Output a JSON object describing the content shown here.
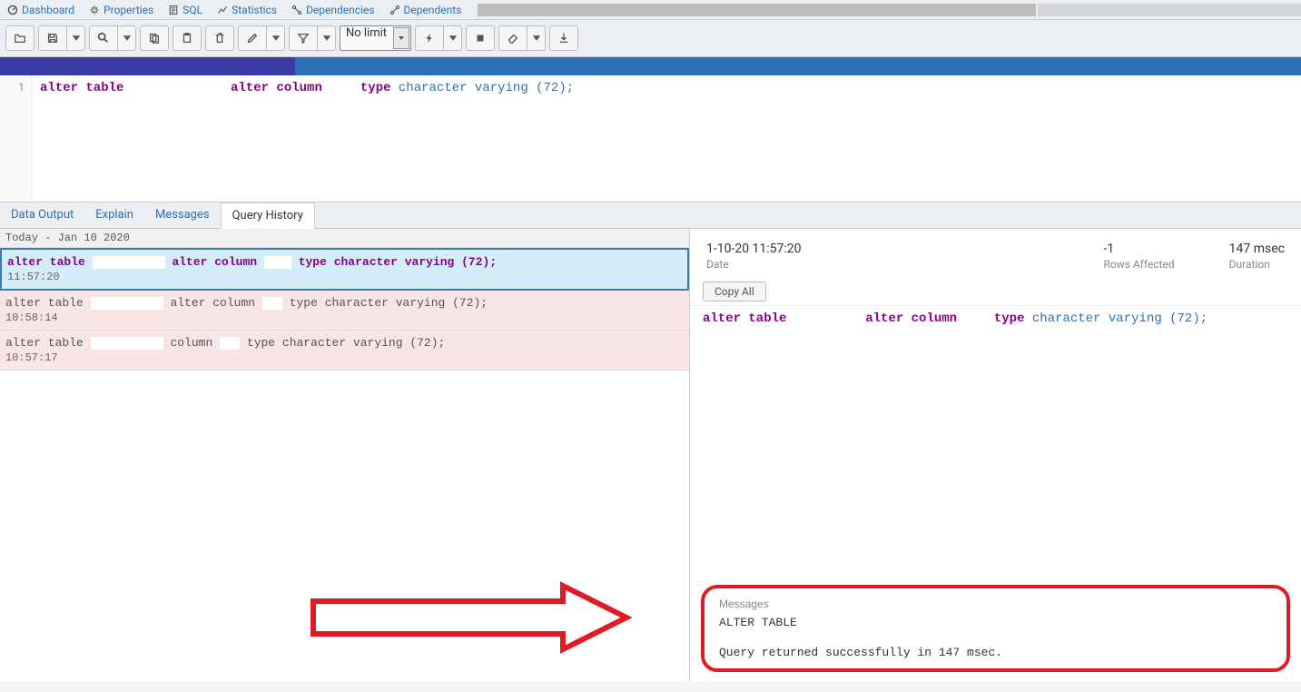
{
  "nav": {
    "dashboard": "Dashboard",
    "properties": "Properties",
    "sql": "SQL",
    "statistics": "Statistics",
    "dependencies": "Dependencies",
    "dependents": "Dependents"
  },
  "toolbar": {
    "limit": "No limit"
  },
  "editor": {
    "line": "1",
    "tokens": [
      "alter table",
      "alter column",
      "type",
      "character varying (72);"
    ]
  },
  "tabs": {
    "data_output": "Data Output",
    "explain": "Explain",
    "messages": "Messages",
    "query_history": "Query History"
  },
  "history": {
    "date_header": "Today - Jan 10 2020",
    "items": [
      {
        "sql_pre": "alter table",
        "sql_mid": "alter column",
        "sql_post": "type character varying (72);",
        "time": "11:57:20",
        "status": "selected"
      },
      {
        "sql_pre": "alter table",
        "sql_mid": "alter column",
        "sql_post": "type character varying (72);",
        "time": "10:58:14",
        "status": "error"
      },
      {
        "sql_pre": "alter table",
        "sql_mid": "column",
        "sql_post": "type character varying (72);",
        "time": "10:57:17",
        "status": "error"
      }
    ]
  },
  "detail": {
    "date_value": "1-10-20 11:57:20",
    "date_label": "Date",
    "rows_value": "-1",
    "rows_label": "Rows Affected",
    "duration_value": "147 msec",
    "duration_label": "Duration",
    "copy_all": "Copy All",
    "sql_pre": "alter table",
    "sql_mid": "alter column",
    "sql_post_kw": "type",
    "sql_post_txt": "character varying (72);",
    "messages_title": "Messages",
    "messages_line1": "ALTER TABLE",
    "messages_line2": "Query returned successfully in 147 msec."
  }
}
